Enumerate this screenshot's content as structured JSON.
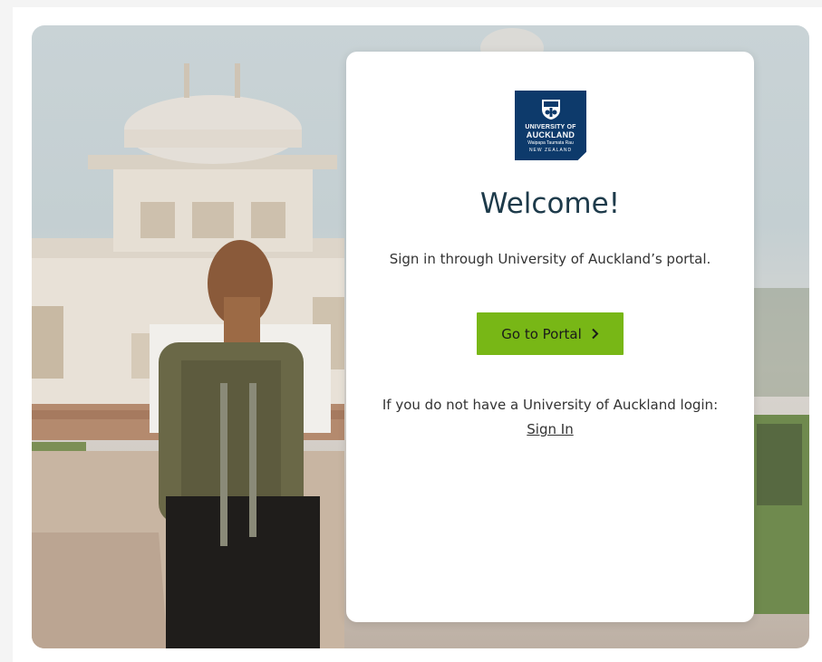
{
  "logo": {
    "line1": "UNIVERSITY OF",
    "line2": "AUCKLAND",
    "line3": "Waipapa Taumata Rau",
    "line4": "NEW ZEALAND"
  },
  "card": {
    "title": "Welcome!",
    "subtitle": "Sign in through University of Auckland’s portal.",
    "portal_button_label": "Go to Portal",
    "no_login_text": "If you do not have a University of Auckland login:",
    "sign_in_link": "Sign In"
  },
  "icons": {
    "portal_button_icon": "chevron-right-icon",
    "logo_crest": "university-crest-icon"
  },
  "colors": {
    "primary_button": "#78b716",
    "logo_background": "#0d3a6b",
    "title_text": "#1d3a4a"
  }
}
